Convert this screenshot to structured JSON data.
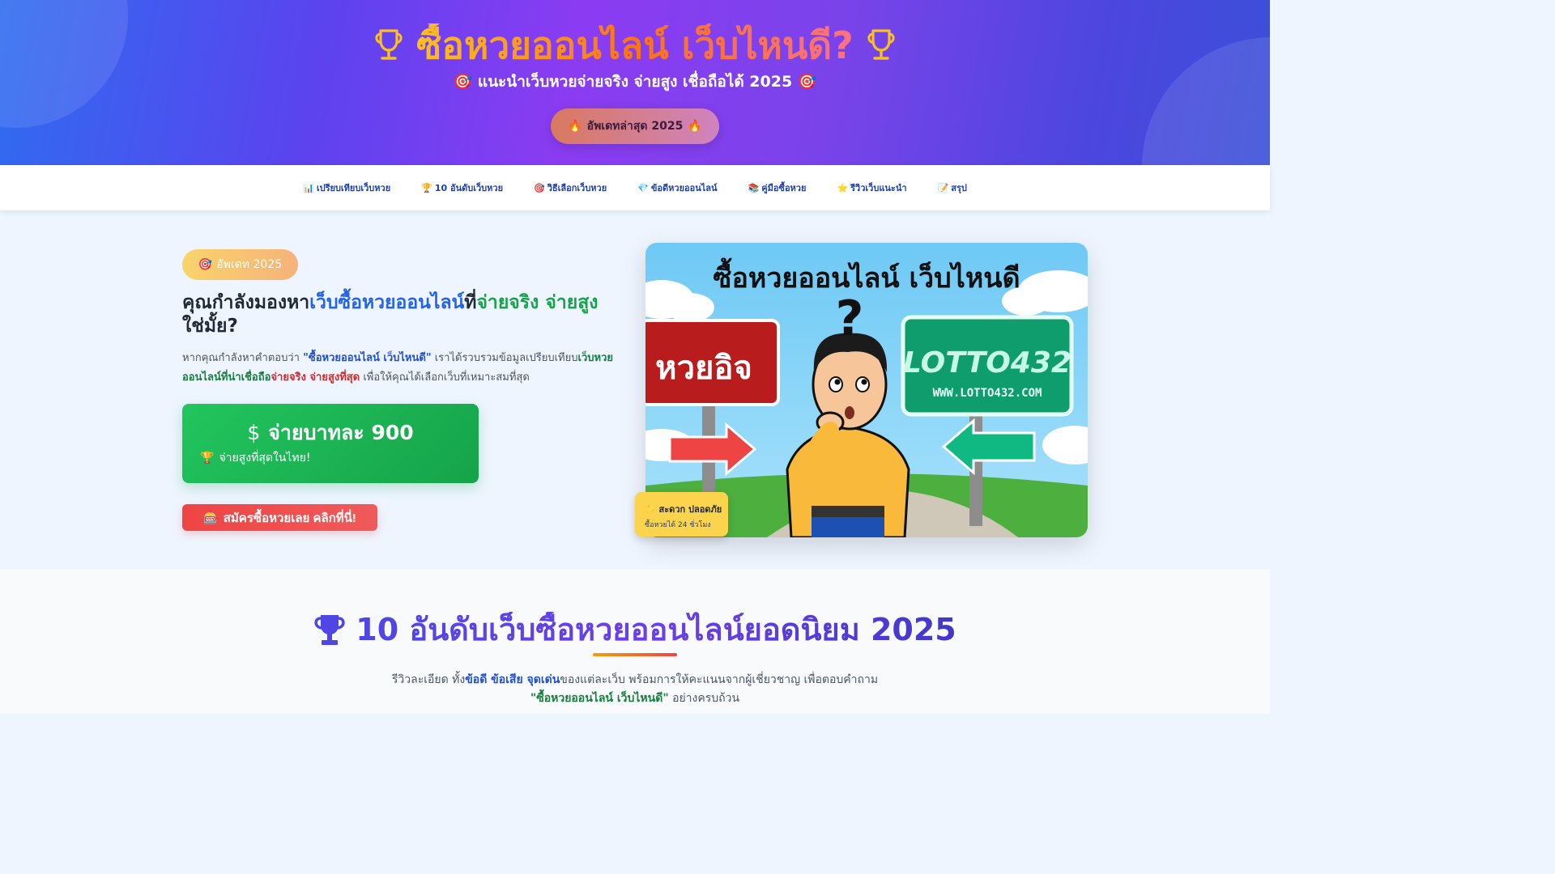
{
  "hero": {
    "title": "ซื้อหวยออนไลน์ เว็บไหนดี?",
    "subtitle": "🎯 แนะนำเว็บหวยจ่ายจริง จ่ายสูง เชื่อถือได้ 2025 🎯",
    "badge_icon": "🔥",
    "badge_label": "อัพเดทล่าสุด 2025",
    "badge_icon_right": "🔥"
  },
  "nav": {
    "items": [
      {
        "icon": "📊",
        "label": "เปรียบเทียบเว็บหวย"
      },
      {
        "icon": "🏆",
        "label": "10 อันดับเว็บหวย"
      },
      {
        "icon": "🎯",
        "label": "วิธีเลือกเว็บหวย"
      },
      {
        "icon": "💎",
        "label": "ข้อดีหวยออนไลน์"
      },
      {
        "icon": "📚",
        "label": "คู่มือซื้อหวย"
      },
      {
        "icon": "⭐",
        "label": "รีวิวเว็บแนะนำ"
      },
      {
        "icon": "📝",
        "label": "สรุป"
      }
    ]
  },
  "main": {
    "pill_icon": "🎯",
    "pill_label": "อัพเดท 2025",
    "headline": {
      "p1": "คุณกำลังมองหา",
      "p2": "เว็บซื้อหวยออนไลน์",
      "p3": "ที่",
      "p4": "จ่ายจริง จ่ายสูง",
      "p5": " ใช่มั้ย?"
    },
    "paragraph": {
      "p1": "หากคุณกำลังหาคำตอบว่า ",
      "p2": "\"ซื้อหวยออนไลน์ เว็บไหนดี\"",
      "p3": " เราได้รวบรวมข้อมูลเปรียบเทียบ",
      "p4": "เว็บหวยออนไลน์ที่น่าเชื่อถือ",
      "p5": "จ่ายจริง จ่ายสูงที่สุด",
      "p6": " เพื่อให้คุณได้เลือกเว็บที่เหมาะสมที่สุด"
    },
    "payout": {
      "icon": "$",
      "label": "จ่ายบาทละ 900",
      "note_icon": "🏆",
      "note": "จ่ายสูงที่สุดในไทย!"
    },
    "cta_icon": "🎰",
    "cta_label": "สมัครซื้อหวยเลย คลิกที่นี่!"
  },
  "illustration": {
    "title": "ซื้อหวยออนไลน์ เว็บไหนดี",
    "left_sign": "หวยอิจ",
    "right_sign_main": "LOTTO432",
    "right_sign_url": "WWW.LOTTO432.COM",
    "question_mark": "?"
  },
  "safe_badge": {
    "icon": "✨",
    "title": "สะดวก ปลอดภัย",
    "subtitle": "ซื้อหวยได้ 24 ชั่วโมง"
  },
  "section": {
    "title": "10 อันดับเว็บซื้อหวยออนไลน์ยอดนิยม 2025",
    "desc": {
      "p1": "รีวิวละเอียด ทั้ง",
      "p2": "ข้อดี ข้อเสีย จุดเด่น",
      "p3": "ของแต่ละเว็บ พร้อมการให้คะแนนจากผู้เชี่ยวชาญ เพื่อตอบคำถาม ",
      "p4": "\"ซื้อหวยออนไลน์ เว็บไหนดี\"",
      "p5": " อย่างครบถ้วน"
    }
  },
  "colors": {
    "accent_blue": "#2563eb",
    "accent_green": "#16a34a",
    "accent_red": "#ef4444",
    "accent_gold": "#fbbf24"
  }
}
